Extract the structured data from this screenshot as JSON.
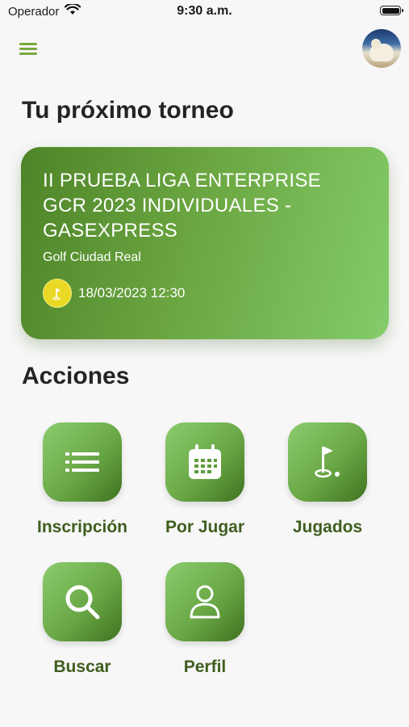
{
  "status_bar": {
    "carrier": "Operador",
    "time": "9:30 a.m."
  },
  "header": {
    "menu_icon": "hamburger-icon",
    "avatar_icon": "avatar"
  },
  "next_tournament": {
    "heading": "Tu próximo torneo",
    "name": "II PRUEBA LIGA ENTERPRISE GCR 2023 INDIVIDUALES - GASEXPRESS",
    "club": "Golf Ciudad Real",
    "datetime": "18/03/2023 12:30",
    "badge_icon": "golf-flag-icon",
    "badge_color": "#e9d925"
  },
  "actions": {
    "heading": "Acciones",
    "items": [
      {
        "label": "Inscripción",
        "icon": "list-icon"
      },
      {
        "label": "Por Jugar",
        "icon": "calendar-icon"
      },
      {
        "label": "Jugados",
        "icon": "golf-flag-icon"
      },
      {
        "label": "Buscar",
        "icon": "search-icon"
      },
      {
        "label": "Perfil",
        "icon": "user-icon"
      }
    ]
  },
  "colors": {
    "accent": "#7aa840",
    "label": "#3f5e1f",
    "background": "#f7f7f7"
  }
}
